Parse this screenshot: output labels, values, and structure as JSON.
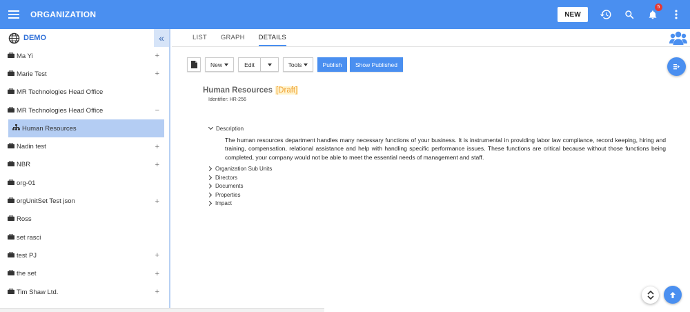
{
  "header": {
    "title": "ORGANIZATION",
    "new_label": "NEW",
    "notification_count": "5",
    "accent": "#4a8ff0"
  },
  "sidebar": {
    "org_name": "DEMO",
    "collapse_glyph": "«",
    "items": [
      {
        "label": "Ma Yi",
        "expander": "+",
        "sub": false
      },
      {
        "label": "Marie Test",
        "expander": "+",
        "sub": false
      },
      {
        "label": "MR Technologies Head Office",
        "expander": "",
        "sub": false
      },
      {
        "label": "MR Technologies Head Office",
        "expander": "−",
        "sub": false
      },
      {
        "label": "Human Resources",
        "expander": "",
        "sub": true
      },
      {
        "label": "Nadin test",
        "expander": "+",
        "sub": false
      },
      {
        "label": "NBR",
        "expander": "+",
        "sub": false
      },
      {
        "label": "org-01",
        "expander": "",
        "sub": false
      },
      {
        "label": "orgUnitSet Test json",
        "expander": "+",
        "sub": false
      },
      {
        "label": "Ross",
        "expander": "",
        "sub": false
      },
      {
        "label": "set rasci",
        "expander": "",
        "sub": false
      },
      {
        "label": "test PJ",
        "expander": "+",
        "sub": false
      },
      {
        "label": "the set",
        "expander": "+",
        "sub": false
      },
      {
        "label": "Tim Shaw Ltd.",
        "expander": "+",
        "sub": false
      }
    ]
  },
  "tabs": [
    {
      "label": "LIST",
      "active": false
    },
    {
      "label": "GRAPH",
      "active": false
    },
    {
      "label": "DETAILS",
      "active": true
    }
  ],
  "toolbar": {
    "new_label": "New",
    "edit_label": "Edit",
    "tools_label": "Tools",
    "publish_label": "Publish",
    "show_published_label": "Show Published"
  },
  "record": {
    "title": "Human Resources",
    "status": "[Draft]",
    "identifier": "Identifier:  HR-256"
  },
  "sections": {
    "description_label": "Description",
    "description_text": "The human resources department handles many necessary functions of your business. It is instrumental in providing labor law compliance, record keeping, hiring and training, compensation, relational assistance and help with handling specific performance issues. These functions are critical because without those functions being completed, your company would not be able to meet the essential needs of management and staff.",
    "collapsed": [
      "Organization Sub Units",
      "Directors",
      "Documents",
      "Properties",
      "Impact"
    ]
  }
}
